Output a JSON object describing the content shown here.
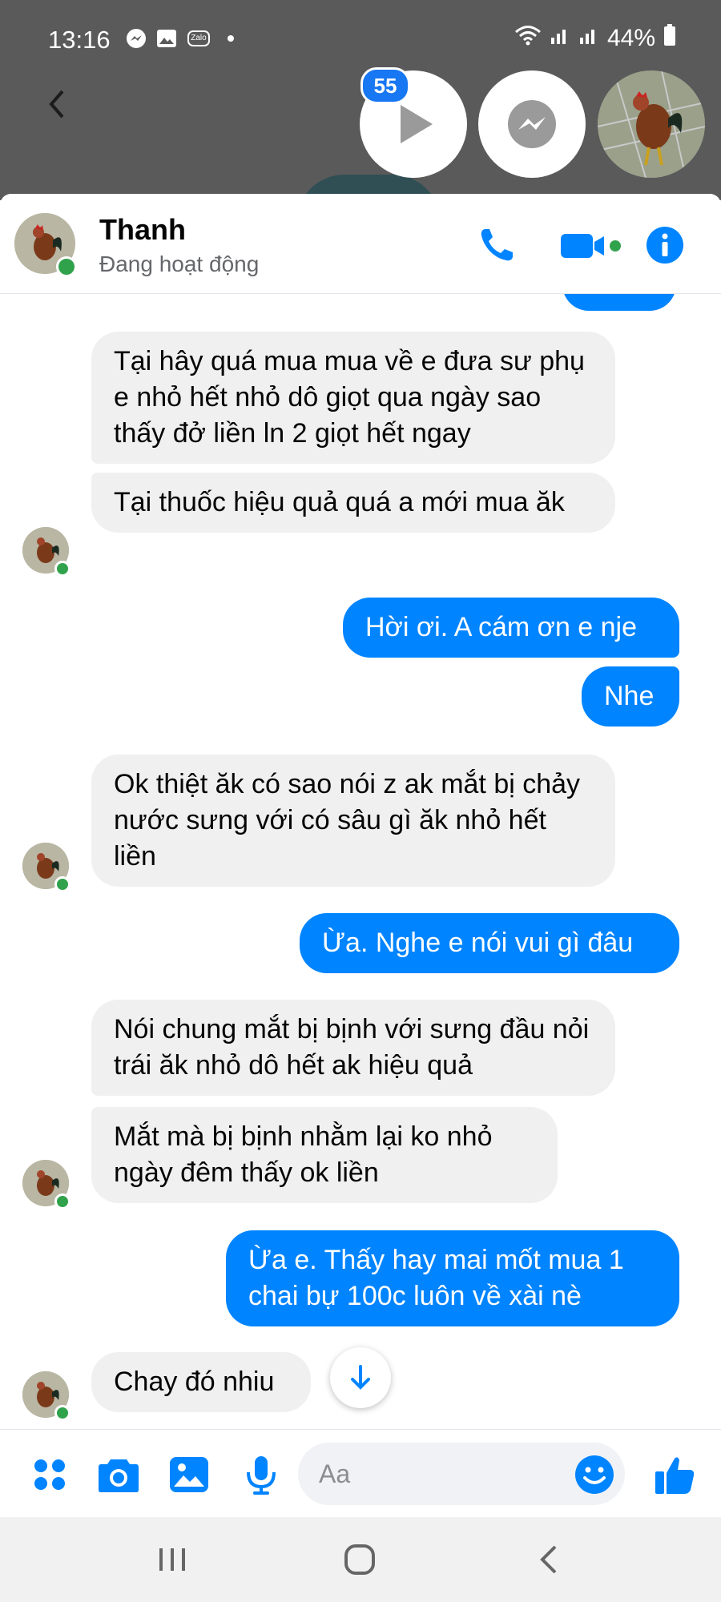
{
  "status_bar": {
    "time": "13:16",
    "battery": "44%",
    "left_icons": [
      "messenger-icon",
      "gallery-icon",
      "zalo-icon",
      "dot-icon"
    ],
    "zalo_label": "Zalo"
  },
  "chat_heads": {
    "badge_count": "55"
  },
  "header": {
    "name": "Thanh",
    "status": "Đang hoạt động"
  },
  "messages": [
    {
      "side": "in",
      "text": "Tại hây quá mua mua về e đưa sư phụ e nhỏ hết nhỏ dô giọt qua ngày sao thấy đở liền ln 2 giọt hết ngay"
    },
    {
      "side": "in",
      "text": "Tại thuốc hiệu quả quá a mới mua ăk"
    },
    {
      "side": "out",
      "text": "Hời ơi. A cám ơn e nje"
    },
    {
      "side": "out",
      "text": "Nhe"
    },
    {
      "side": "in",
      "text": "Ok thiệt ăk có sao nói z ak mắt bị chảy nước sưng với có sâu gì ăk nhỏ hết liền"
    },
    {
      "side": "out",
      "text": "Ừa. Nghe e nói vui gì đâu"
    },
    {
      "side": "in",
      "text": "Nói chung mắt bị bịnh với sưng đầu nỏi trái ăk nhỏ dô hết ak hiệu quả"
    },
    {
      "side": "in",
      "text": "Mắt mà bị bịnh nhằm lại ko nhỏ ngày đêm thấy ok liền"
    },
    {
      "side": "out",
      "text": "Ừa e. Thấy hay mai mốt mua 1 chai bự 100c luôn về xài nè"
    },
    {
      "side": "in",
      "text": "Chay đó nhiu"
    }
  ],
  "composer": {
    "placeholder": "Aa"
  },
  "colors": {
    "accent": "#0084ff",
    "incoming_bubble": "#f0f0f0",
    "online": "#31a24c",
    "top_overlay": "#5a5a5a"
  }
}
